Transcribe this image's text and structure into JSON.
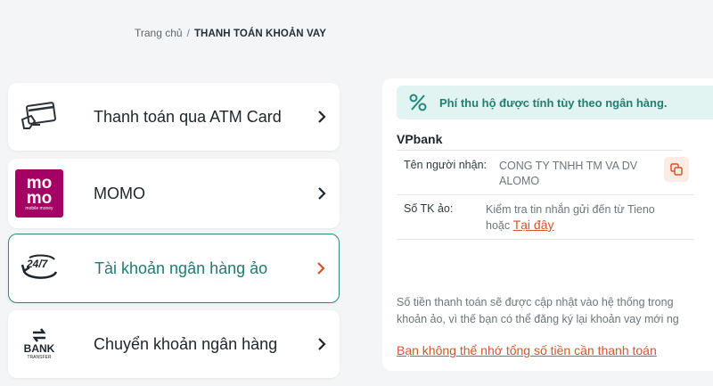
{
  "breadcrumb": {
    "home": "Trang chủ",
    "separator": "/",
    "current": "THANH TOÁN KHOẢN VAY"
  },
  "methods": [
    {
      "label": "Thanh toán qua ATM Card",
      "icon": "atm-card-icon",
      "active": false
    },
    {
      "label": "MOMO",
      "icon": "momo-logo",
      "logo_text": [
        "mo",
        "mo",
        "mobile money"
      ],
      "active": false
    },
    {
      "label": "Tài khoản ngân hàng ảo",
      "icon": "24-7-icon",
      "active": true
    },
    {
      "label": "Chuyển khoản ngân hàng",
      "icon": "bank-transfer-icon",
      "logo_text": [
        "BANK",
        "TRANSFER"
      ],
      "active": false
    }
  ],
  "panel": {
    "notice": "Phí thu hộ được tính tùy theo ngân hàng.",
    "bank_name": "VPbank",
    "recipient_label": "Tên người nhận:",
    "recipient_value_line1": "CONG TY TNHH TM VA DV",
    "recipient_value_line2": "ALOMO",
    "account_label": "Số TK ảo:",
    "account_value_line1": "Kiểm tra tin nhắn gửi đến từ Tieno",
    "account_value_prefix": "hoặc",
    "account_link": "Tại đây",
    "footnote_line1": "Số tiền thanh toán sẽ được cập nhật vào hệ thống trong",
    "footnote_line2": "khoản ảo, vì thế bạn có thể đăng ký lại khoản vay mới ng",
    "forgot_link": "Bạn không thể nhớ tổng số tiền cần thanh toán"
  },
  "colors": {
    "accent": "#2d8a82",
    "link": "#d9532b",
    "notice_bg": "#e2f4f1",
    "momo": "#a50064"
  }
}
